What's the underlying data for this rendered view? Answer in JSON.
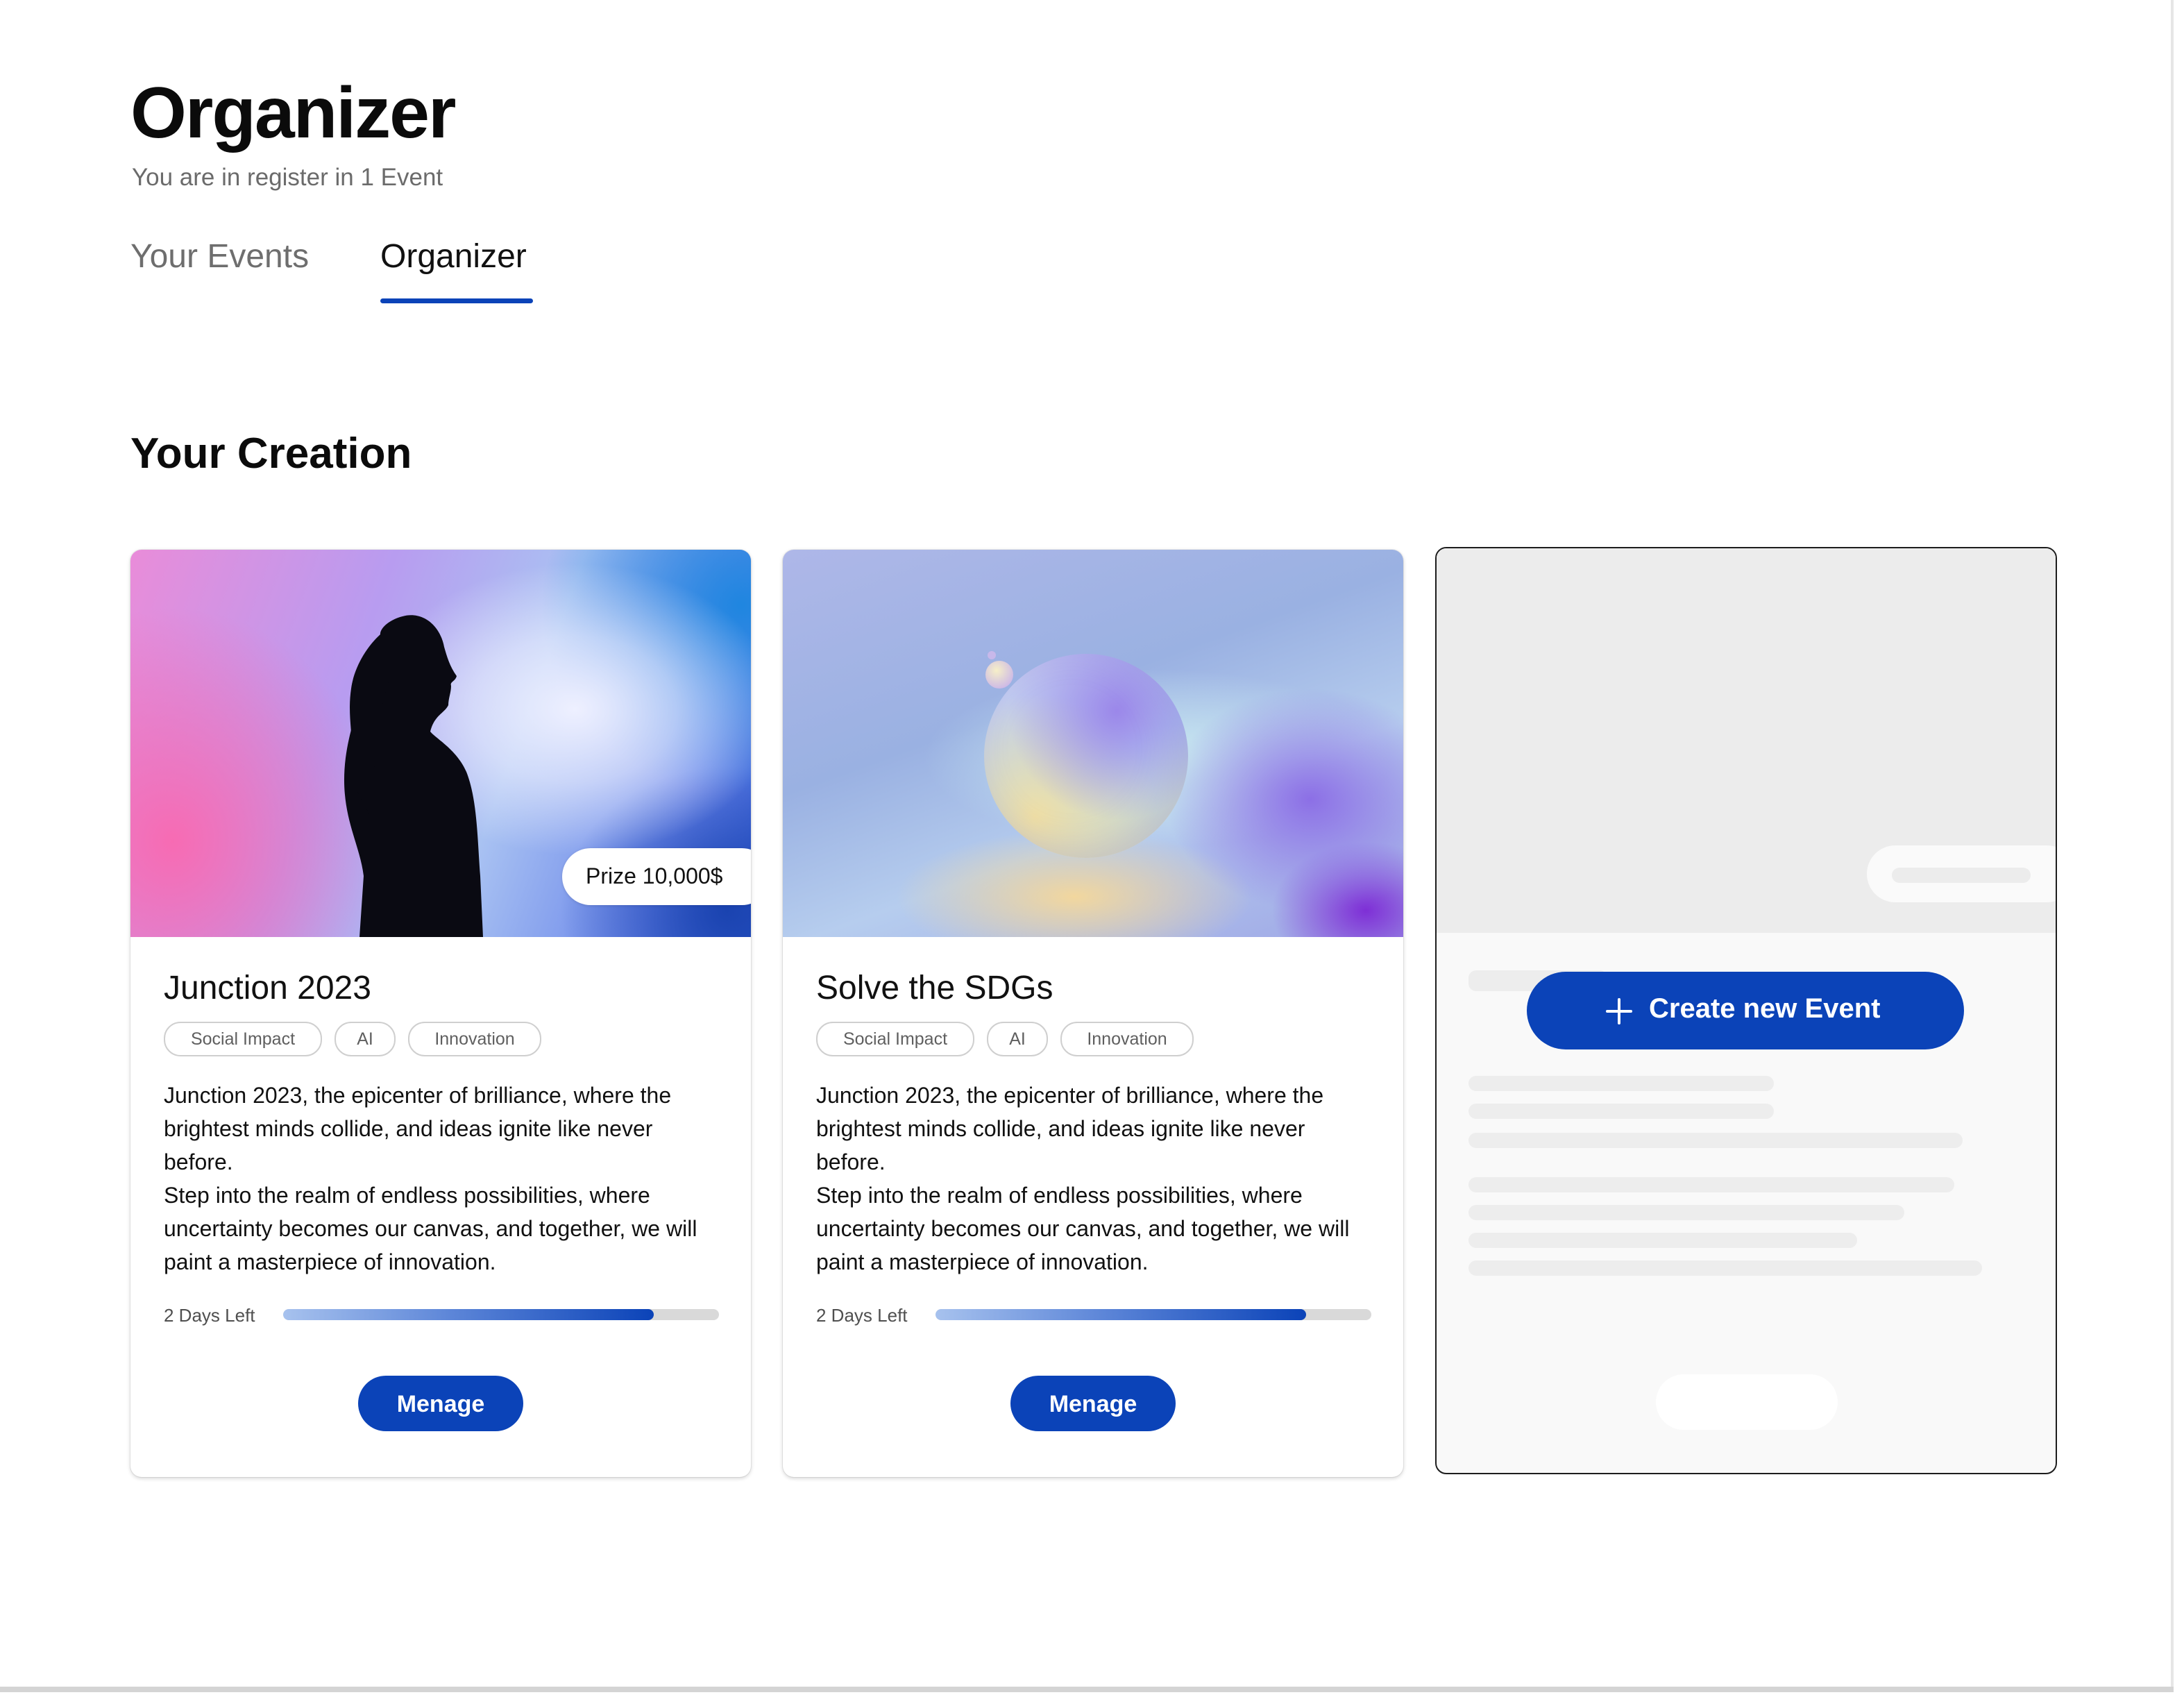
{
  "header": {
    "title": "Organizer",
    "subtitle": "You are in register in 1 Event"
  },
  "tabs": [
    {
      "label": "Your Events",
      "active": false
    },
    {
      "label": "Organizer",
      "active": true
    }
  ],
  "section_title": "Your Creation",
  "colors": {
    "accent": "#0b43b8",
    "tag_border": "#cfcfcf",
    "progress_track": "#d9d9d9",
    "placeholder": "#ececec"
  },
  "cards": [
    {
      "title": "Junction 2023",
      "prize": "Prize 10,000$",
      "tags": [
        "Social Impact",
        "AI",
        "Innovation"
      ],
      "description": [
        "Junction 2023, the epicenter of brilliance, where the brightest minds collide, and ideas ignite like never before.",
        "Step into the realm of endless possibilities, where uncertainty becomes our canvas, and together, we will paint a masterpiece of innovation."
      ],
      "days_left": "2 Days Left",
      "progress": 0.85,
      "button": "Menage"
    },
    {
      "title": "Solve the SDGs",
      "tags": [
        "Social Impact",
        "AI",
        "Innovation"
      ],
      "description": [
        "Junction 2023, the epicenter of brilliance, where the brightest minds collide, and ideas ignite like never before.",
        "Step into the realm of endless possibilities, where uncertainty becomes our canvas, and together, we will paint a masterpiece of innovation."
      ],
      "days_left": "2 Days Left",
      "progress": 0.85,
      "button": "Menage"
    }
  ],
  "create_card": {
    "button": "Create new Event",
    "icon": "plus-icon"
  }
}
